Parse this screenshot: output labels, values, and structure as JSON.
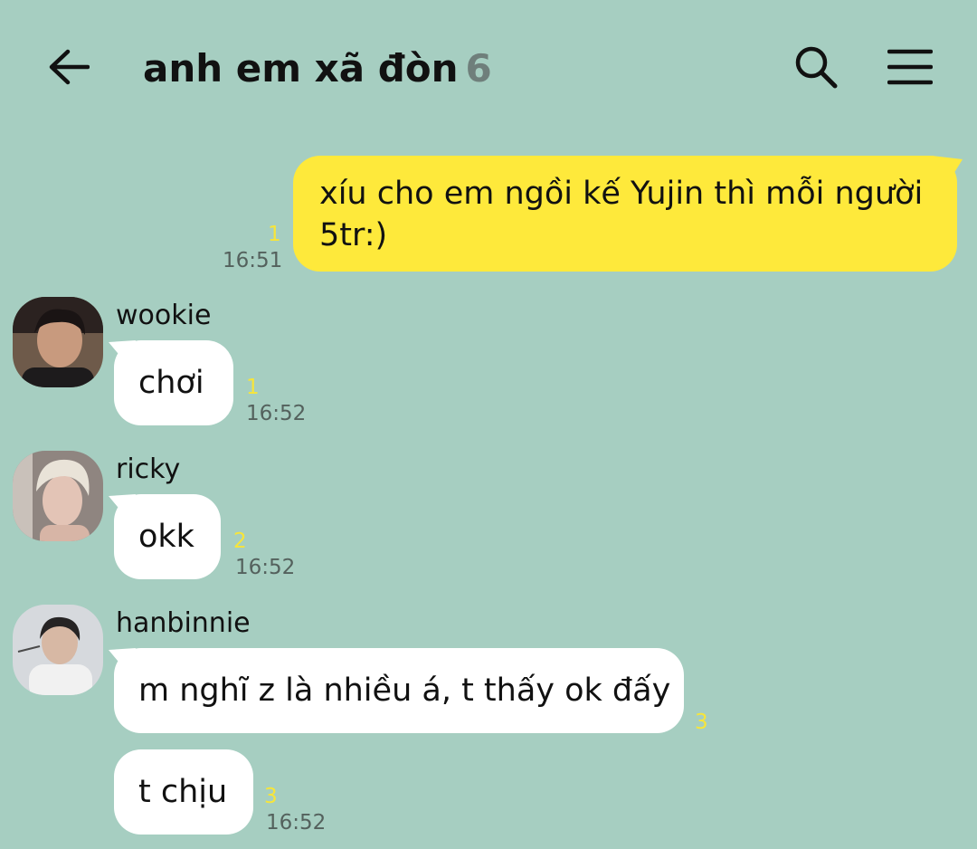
{
  "header": {
    "title": "anh em xã đòn",
    "member_count": "6"
  },
  "icons": {
    "back": "arrow-left-icon",
    "search": "search-icon",
    "menu": "hamburger-menu-icon"
  },
  "colors": {
    "background": "#a6cec1",
    "my_bubble": "#fee93b",
    "their_bubble": "#ffffff",
    "unread_count": "#f7e53a"
  },
  "messages": [
    {
      "sender": "me",
      "line1": "xíu cho em ngồi kế Yujin thì mỗi người",
      "line2": "5tr:)",
      "unread": "1",
      "time": "16:51"
    },
    {
      "sender": "wookie",
      "text": "chơi",
      "unread": "1",
      "time": "16:52"
    },
    {
      "sender": "ricky",
      "text": "okk",
      "unread": "2",
      "time": "16:52"
    },
    {
      "sender": "hanbinnie",
      "text": "m nghĩ z là nhiều á, t thấy ok đấy",
      "unread": "3",
      "time": ""
    },
    {
      "sender": "hanbinnie",
      "text": "t chịu",
      "unread": "3",
      "time": "16:52"
    }
  ]
}
